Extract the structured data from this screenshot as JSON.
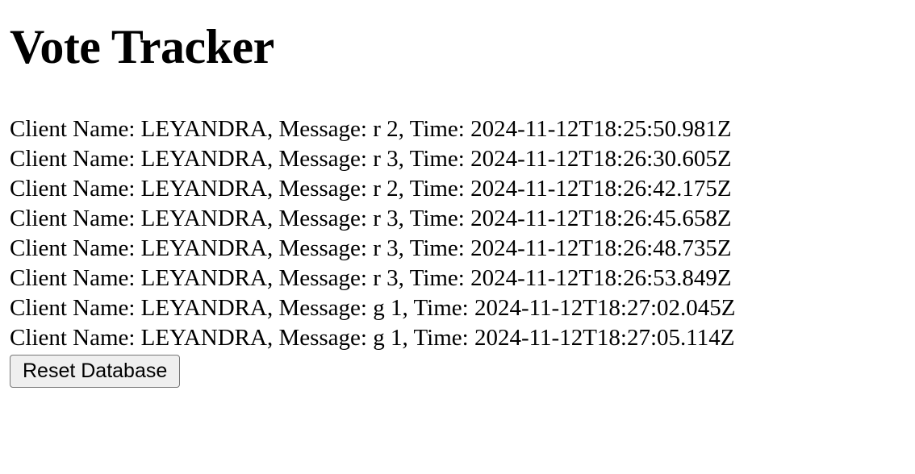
{
  "page": {
    "title": "Vote Tracker"
  },
  "votes": [
    "Client Name: LEYANDRA, Message: r 2, Time: 2024-11-12T18:25:50.981Z",
    "Client Name: LEYANDRA, Message: r 3, Time: 2024-11-12T18:26:30.605Z",
    "Client Name: LEYANDRA, Message: r 2, Time: 2024-11-12T18:26:42.175Z",
    "Client Name: LEYANDRA, Message: r 3, Time: 2024-11-12T18:26:45.658Z",
    "Client Name: LEYANDRA, Message: r 3, Time: 2024-11-12T18:26:48.735Z",
    "Client Name: LEYANDRA, Message: r 3, Time: 2024-11-12T18:26:53.849Z",
    "Client Name: LEYANDRA, Message: g 1, Time: 2024-11-12T18:27:02.045Z",
    "Client Name: LEYANDRA, Message: g 1, Time: 2024-11-12T18:27:05.114Z"
  ],
  "actions": {
    "reset_label": "Reset Database"
  }
}
